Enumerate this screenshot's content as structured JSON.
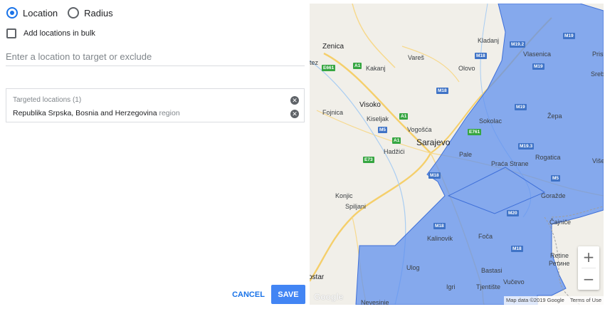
{
  "targeting": {
    "options": [
      {
        "label": "Location",
        "selected": true
      },
      {
        "label": "Radius",
        "selected": false
      }
    ],
    "bulk_label": "Add locations in bulk",
    "search_placeholder": "Enter a location to target or exclude"
  },
  "targeted": {
    "title": "Targeted locations (1)",
    "items": [
      {
        "name": "Republika Srpska, Bosnia and Herzegovina",
        "type": "region"
      }
    ]
  },
  "actions": {
    "cancel": "CANCEL",
    "save": "SAVE"
  },
  "map": {
    "region_color": "#5b8def",
    "places": [
      "Zenica",
      "itez",
      "Vareš",
      "Kladanj",
      "Vlasenica",
      "Kakanj",
      "Olovo",
      "Visoko",
      "Fojnica",
      "Kiseljak",
      "Vogošća",
      "Sarajevo",
      "Hadžići",
      "Sokolac",
      "Pale",
      "Praća Strane",
      "Rogatica",
      "Žepa",
      "Konjic",
      "Spiljani",
      "Goražde",
      "Čajniče",
      "Kalinovik",
      "Foča",
      "Ulog",
      "Bastasi",
      "Igri",
      "Tjentište",
      "Vučevo",
      "Retine",
      "Ретине",
      "ostar",
      "Nevesinje",
      "Prist",
      "Sreb",
      "Više"
    ],
    "roads": {
      "green": [
        "E661",
        "A1",
        "A1",
        "A1",
        "E73",
        "E761"
      ],
      "blue": [
        "M19.2",
        "M18",
        "M18",
        "M19",
        "M19",
        "M5",
        "M19",
        "M19.3",
        "M18",
        "M5",
        "M20",
        "M18",
        "M18"
      ]
    },
    "zoom_in": "+",
    "zoom_out": "−",
    "logo": "Google",
    "attribution": "Map data ©2019 Google",
    "terms": "Terms of Use"
  }
}
